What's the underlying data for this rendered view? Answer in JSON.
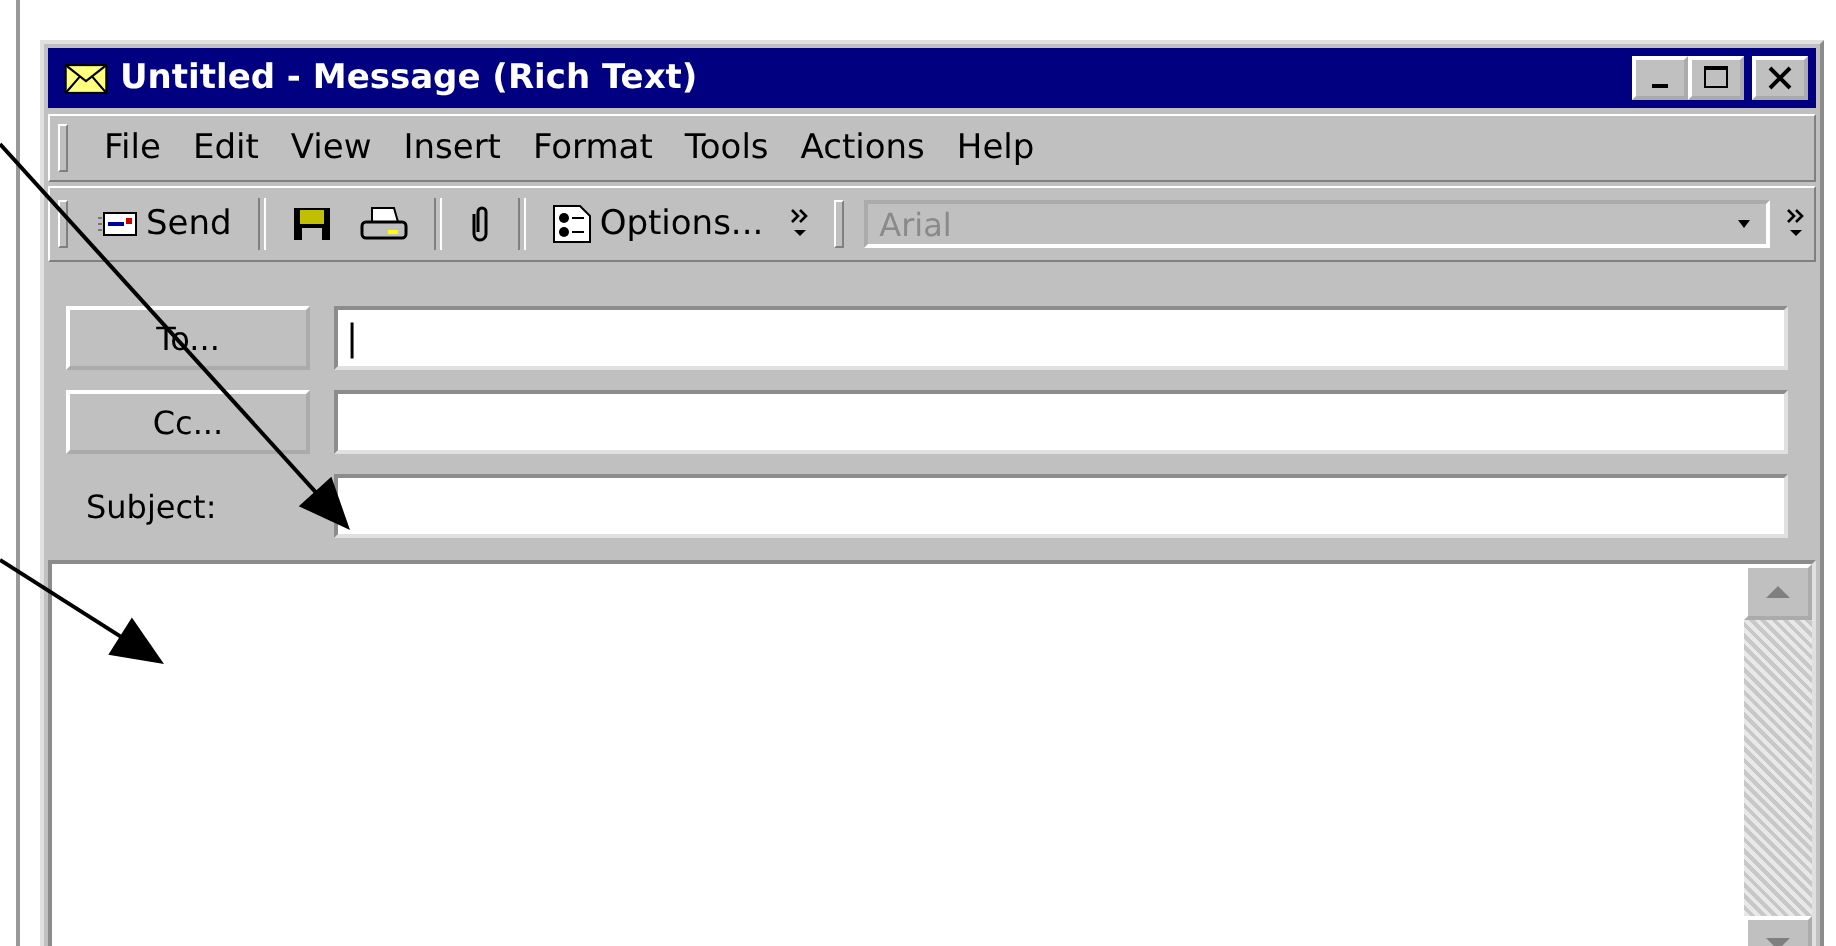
{
  "window": {
    "title": "Untitled - Message (Rich Text)",
    "controls": [
      {
        "kind": "minimize"
      },
      {
        "kind": "maximize"
      },
      {
        "kind": "close"
      }
    ]
  },
  "menu": [
    "File",
    "Edit",
    "View",
    "Insert",
    "Format",
    "Tools",
    "Actions",
    "Help"
  ],
  "toolbar": [
    {
      "kind": "send",
      "label": "Send"
    },
    {
      "kind": "sep"
    },
    {
      "kind": "save"
    },
    {
      "kind": "print"
    },
    {
      "kind": "sep"
    },
    {
      "kind": "attach"
    },
    {
      "kind": "sep"
    },
    {
      "kind": "options",
      "label": "Options..."
    },
    {
      "kind": "more"
    }
  ],
  "font_box": {
    "value": "Arial",
    "disabled": true
  },
  "address": [
    {
      "kind": "button",
      "label": "To...",
      "value": "|"
    },
    {
      "kind": "button",
      "label": "Cc..."
    },
    {
      "kind": "label",
      "label": "Subject:"
    }
  ],
  "annotations": [
    {
      "kind": "arrow"
    },
    {
      "kind": "arrow"
    }
  ]
}
